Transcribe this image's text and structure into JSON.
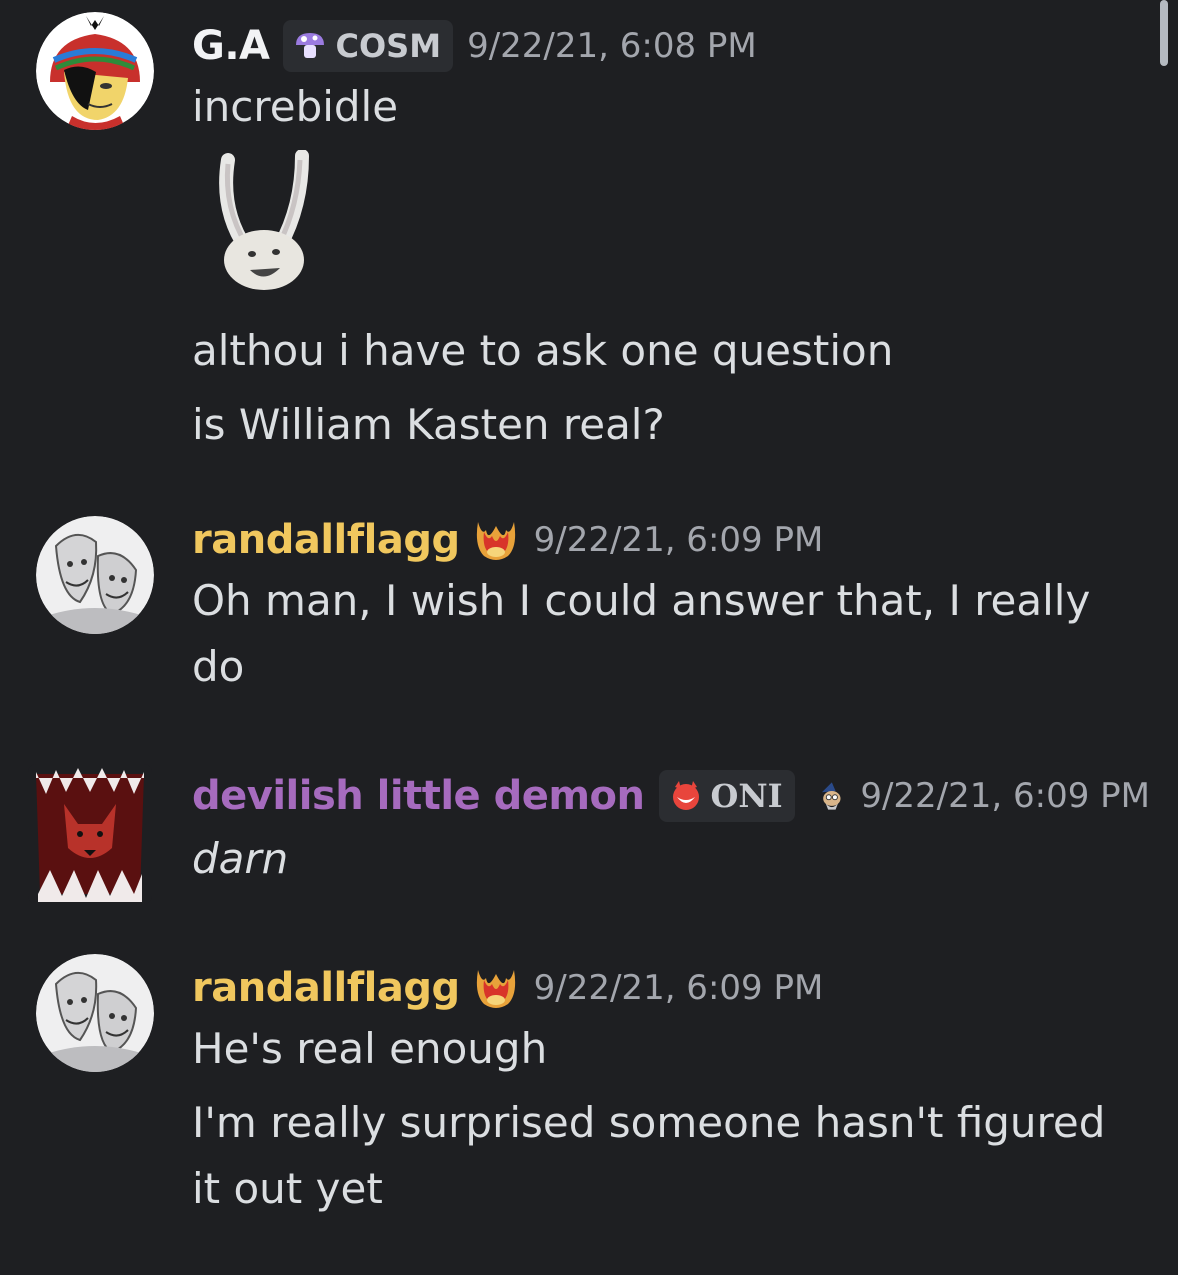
{
  "messages": [
    {
      "username": "G.A",
      "username_color": "#f2f3f5",
      "tag": "COSM",
      "timestamp": "9/22/21, 6:08 PM",
      "lines": [
        "increbidle",
        "althou i have to ask one question",
        "is William Kasten real?"
      ]
    },
    {
      "username": "randallflagg",
      "username_color": "#f0c75e",
      "timestamp": "9/22/21, 6:09 PM",
      "lines": [
        "Oh man, I wish I could answer that, I really",
        "do"
      ]
    },
    {
      "username": "devilish little demon",
      "username_color": "#a66bbe",
      "tag": "ONI",
      "timestamp": "9/22/21, 6:09 PM",
      "lines": [
        "darn"
      ]
    },
    {
      "username": "randallflagg",
      "username_color": "#f0c75e",
      "timestamp": "9/22/21, 6:09 PM",
      "lines": [
        "He's real enough",
        "I'm really surprised someone hasn't figured",
        "it out yet"
      ]
    }
  ]
}
